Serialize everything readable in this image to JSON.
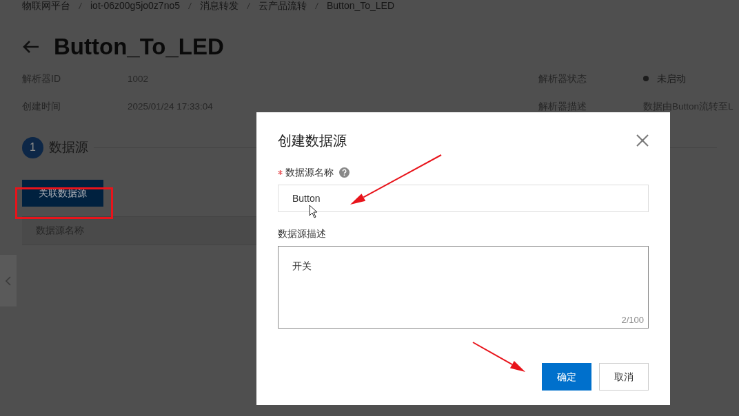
{
  "breadcrumb": [
    "物联网平台",
    "iot-06z00g5jo0z7no5",
    "消息转发",
    "云产品流转",
    "Button_To_LED"
  ],
  "title": "Button_To_LED",
  "details": [
    {
      "kind": "text",
      "label": "解析器ID",
      "value": "1002"
    },
    {
      "kind": "status",
      "label": "解析器状态",
      "value": "未启动"
    },
    {
      "kind": "text",
      "label": "创建时间",
      "value": "2025/01/24 17:33:04"
    },
    {
      "kind": "text",
      "label": "解析器描述",
      "value": "数据由Button流转至L"
    }
  ],
  "step": {
    "number": "1",
    "title": "数据源"
  },
  "link_button": "关联数据源",
  "table": {
    "columns": [
      "数据源名称"
    ]
  },
  "dialog": {
    "title": "创建数据源",
    "fields": [
      {
        "kind": "input",
        "label": "数据源名称",
        "required": true,
        "help": true,
        "value": "Button"
      },
      {
        "kind": "textarea",
        "label": "数据源描述",
        "required": false,
        "help": false,
        "value": "开关",
        "counter": "2/100"
      }
    ],
    "buttons": [
      {
        "label": "确定",
        "primary": true
      },
      {
        "label": "取消",
        "primary": false
      }
    ]
  },
  "annotations": [
    {
      "kind": "box"
    },
    {
      "kind": "arrow"
    },
    {
      "kind": "arrow"
    }
  ]
}
